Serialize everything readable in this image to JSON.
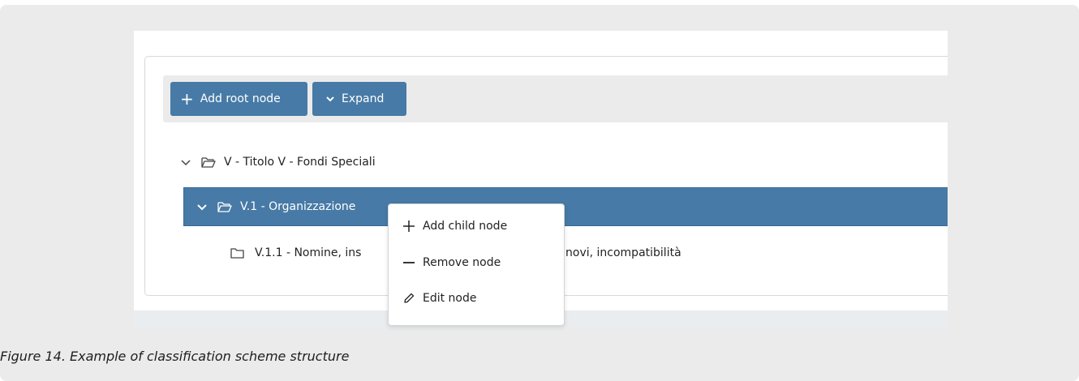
{
  "toolbar": {
    "add_root_label": "Add root node",
    "expand_label": "Expand"
  },
  "tree": {
    "nodes": [
      {
        "label": "V - Titolo V - Fondi Speciali",
        "expanded": true,
        "selected": false
      },
      {
        "label": "V.1 - Organizzazione, gestione fondi speciali",
        "expanded": true,
        "selected": true
      },
      {
        "label": "V.1.1 - Nomine, insediamenti, rinnovi, incompatibilità",
        "expanded": false,
        "selected": false
      }
    ],
    "selected_visible_start": "V.1 - Organizzazione",
    "row3_visible_start": "V.1.1 - Nomine, ins",
    "row3_visible_end": "novi, incompatibilità"
  },
  "context_menu": {
    "items": [
      {
        "label": "Add child node",
        "icon": "plus-icon"
      },
      {
        "label": "Remove node",
        "icon": "minus-icon"
      },
      {
        "label": "Edit node",
        "icon": "pencil-icon"
      }
    ]
  },
  "caption": "Figure 14. Example of classification scheme structure",
  "colors": {
    "accent": "#477aa6",
    "background": "#ebebeb"
  }
}
